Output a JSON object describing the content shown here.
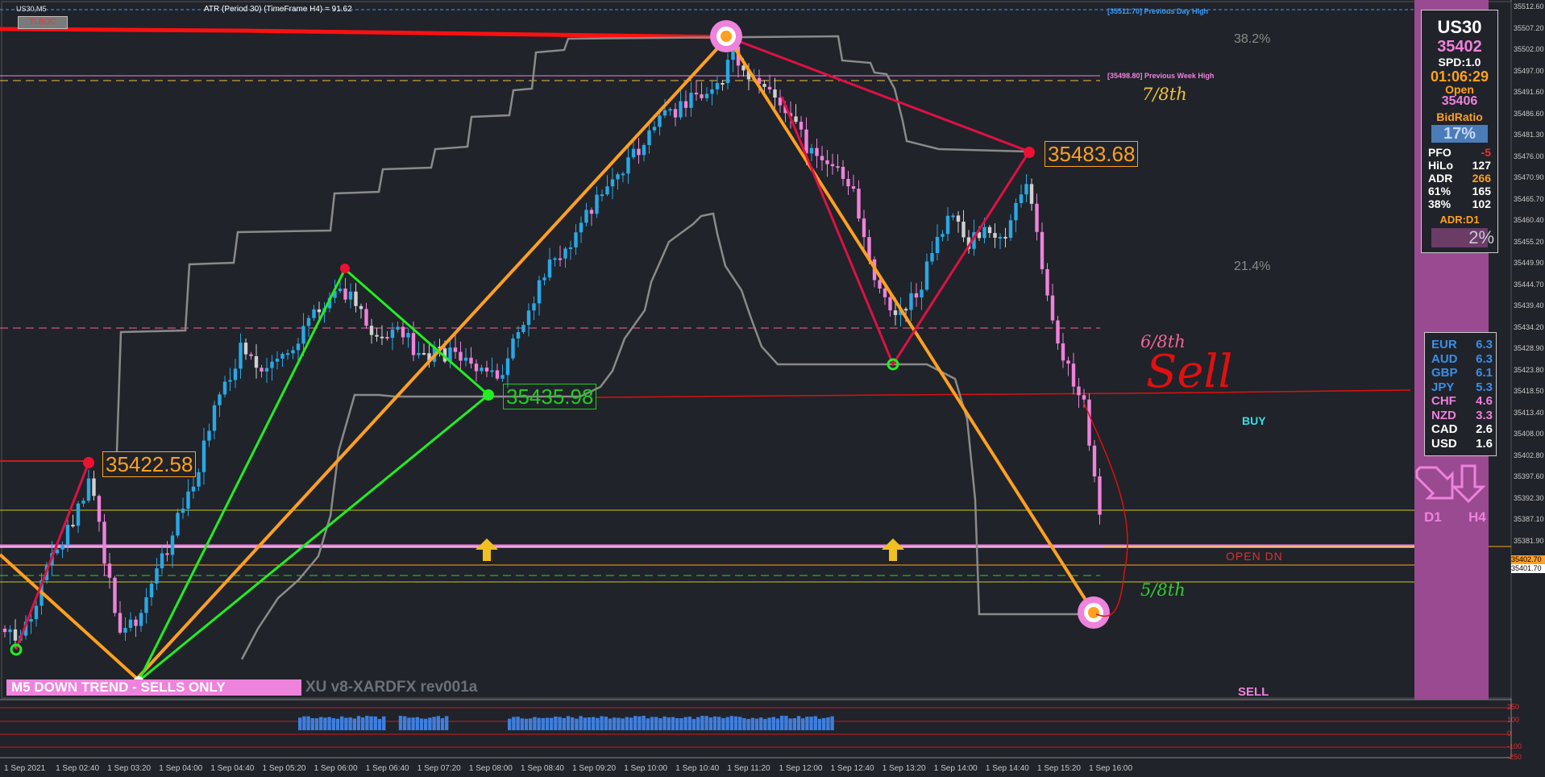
{
  "window": {
    "symbol_tf": "US30,M5",
    "atr_text": "ATR (Period 30) (TimeFrame H4) = 91.62",
    "tlboc_label": "TLBOC"
  },
  "levels": {
    "prev_day_high": "[35511.70] Previous Day High",
    "prev_week_high": "[35498.80] Previous Week High",
    "fib_38": "38.2%",
    "fib_21": "21.4%"
  },
  "labels": {
    "seven_eighths": "7/8th",
    "six_eighths": "6/8th",
    "five_eighths": "5/8th",
    "sell_handwritten": "Sell",
    "buy": "BUY",
    "open_dn": "OPEN DN",
    "sell": "SELL",
    "price_35483": "35483.68",
    "price_35422": "35422.58",
    "price_35435": "35435.98"
  },
  "banner": {
    "trend": "M5  DOWN TREND - SELLS ONLY",
    "version": "XU v8-XARDFX rev001a"
  },
  "info_panel": {
    "symbol": "US30",
    "price": "35402",
    "spread": "SPD:1.0",
    "timer": "01:06:29",
    "open_label": "Open",
    "open_value": "35406",
    "bid_ratio_label": "BidRatio",
    "bid_ratio_value": "17%",
    "stats": [
      {
        "label": "PFO",
        "value": "-5"
      },
      {
        "label": "HiLo",
        "value": "127"
      },
      {
        "label": "ADR",
        "value": "266"
      },
      {
        "label": "61%",
        "value": "165"
      },
      {
        "label": "38%",
        "value": "102"
      }
    ],
    "adr_tf": "ADR:D1",
    "adr_pct": "2%"
  },
  "currency_strength": [
    {
      "currency": "EUR",
      "value": "6.3",
      "color": "#3a8ee8"
    },
    {
      "currency": "AUD",
      "value": "6.3",
      "color": "#3a8ee8"
    },
    {
      "currency": "GBP",
      "value": "6.1",
      "color": "#3a8ee8"
    },
    {
      "currency": "JPY",
      "value": "5.3",
      "color": "#3a8ee8"
    },
    {
      "currency": "CHF",
      "value": "4.6",
      "color": "#ee7fdc"
    },
    {
      "currency": "NZD",
      "value": "3.3",
      "color": "#ee7fdc"
    },
    {
      "currency": "CAD",
      "value": "2.6",
      "color": "#ffffff"
    },
    {
      "currency": "USD",
      "value": "1.6",
      "color": "#ffffff"
    }
  ],
  "trend_arrows": {
    "d1": "D1",
    "h4": "H4"
  },
  "price_axis": {
    "ticks": [
      "35512.60",
      "35507.20",
      "35502.00",
      "35497.00",
      "35491.60",
      "35486.60",
      "35481.30",
      "35476.00",
      "35470.90",
      "35465.70",
      "35460.40",
      "35455.20",
      "35449.90",
      "35444.70",
      "35439.40",
      "35434.20",
      "35428.90",
      "35423.80",
      "35418.50",
      "35413.40",
      "35408.00",
      "35402.80",
      "35397.60",
      "35392.30",
      "35387.10",
      "35381.90",
      "35376.60"
    ],
    "current_price": "35401.70",
    "open_price": "35402.70"
  },
  "osc_axis": {
    "ticks": [
      "250",
      "100",
      "0",
      "-100",
      "-250"
    ]
  },
  "time_axis": {
    "ticks": [
      "1 Sep 2021",
      "1 Sep 02:40",
      "1 Sep 03:20",
      "1 Sep 04:00",
      "1 Sep 04:40",
      "1 Sep 05:20",
      "1 Sep 06:00",
      "1 Sep 06:40",
      "1 Sep 07:20",
      "1 Sep 08:00",
      "1 Sep 08:40",
      "1 Sep 09:20",
      "1 Sep 10:00",
      "1 Sep 10:40",
      "1 Sep 11:20",
      "1 Sep 12:00",
      "1 Sep 12:40",
      "1 Sep 13:20",
      "1 Sep 14:00",
      "1 Sep 14:40",
      "1 Sep 15:20",
      "1 Sep 16:00"
    ]
  },
  "colors": {
    "background": "#202329",
    "bull_candle": "#29a8e6",
    "bear_candle": "#ee82dc",
    "neutral_candle": "#d0d0d0",
    "zigzag_orange": "#ffa020",
    "zigzag_green": "#22ee22",
    "zigzag_red": "#dd1144",
    "panel": "#9a4a90"
  }
}
